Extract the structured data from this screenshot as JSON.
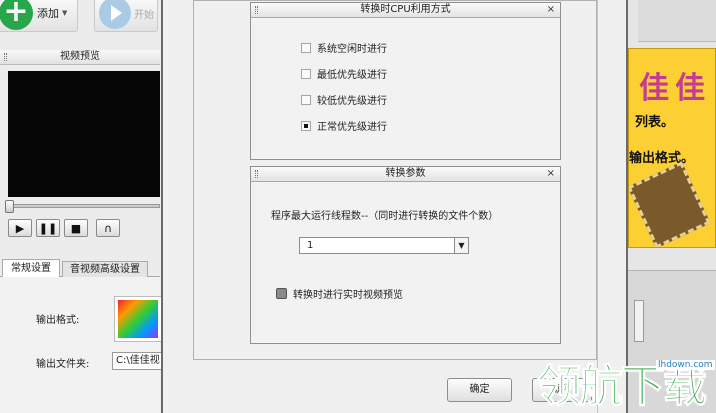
{
  "toolbar": {
    "add_label": "添加",
    "start_label": "开始"
  },
  "preview": {
    "title": "视频预览"
  },
  "settings": {
    "tabs": [
      {
        "label": "常规设置"
      },
      {
        "label": "音视频高级设置"
      }
    ],
    "output_format_label": "输出格式:",
    "output_folder_label": "输出文件夹:",
    "output_folder_value": "C:\\佳佳视"
  },
  "banner": {
    "logo": "佳佳",
    "line1": "列表。",
    "line2": "输出格式。"
  },
  "dialog": {
    "cpu_panel": {
      "title": "转换时CPU利用方式",
      "options": [
        {
          "label": "系统空闲时进行",
          "checked": false
        },
        {
          "label": "最低优先级进行",
          "checked": false
        },
        {
          "label": "较低优先级进行",
          "checked": false
        },
        {
          "label": "正常优先级进行",
          "checked": true
        }
      ]
    },
    "param_panel": {
      "title": "转换参数",
      "max_threads_label": "程序最大运行线程数--（同时进行转换的文件个数）",
      "max_threads_value": "1",
      "realtime_preview_label": "转换时进行实时视频预览"
    },
    "ok_label": "确定",
    "cancel_label": "取消"
  },
  "watermark": {
    "text": "领航下载",
    "url": "lhdown.com"
  },
  "colors": {
    "accent_green": "#27a64a",
    "banner_yellow": "#fccf33",
    "arrow_red": "#e02a2a",
    "watermark_green": "#25a83a"
  }
}
